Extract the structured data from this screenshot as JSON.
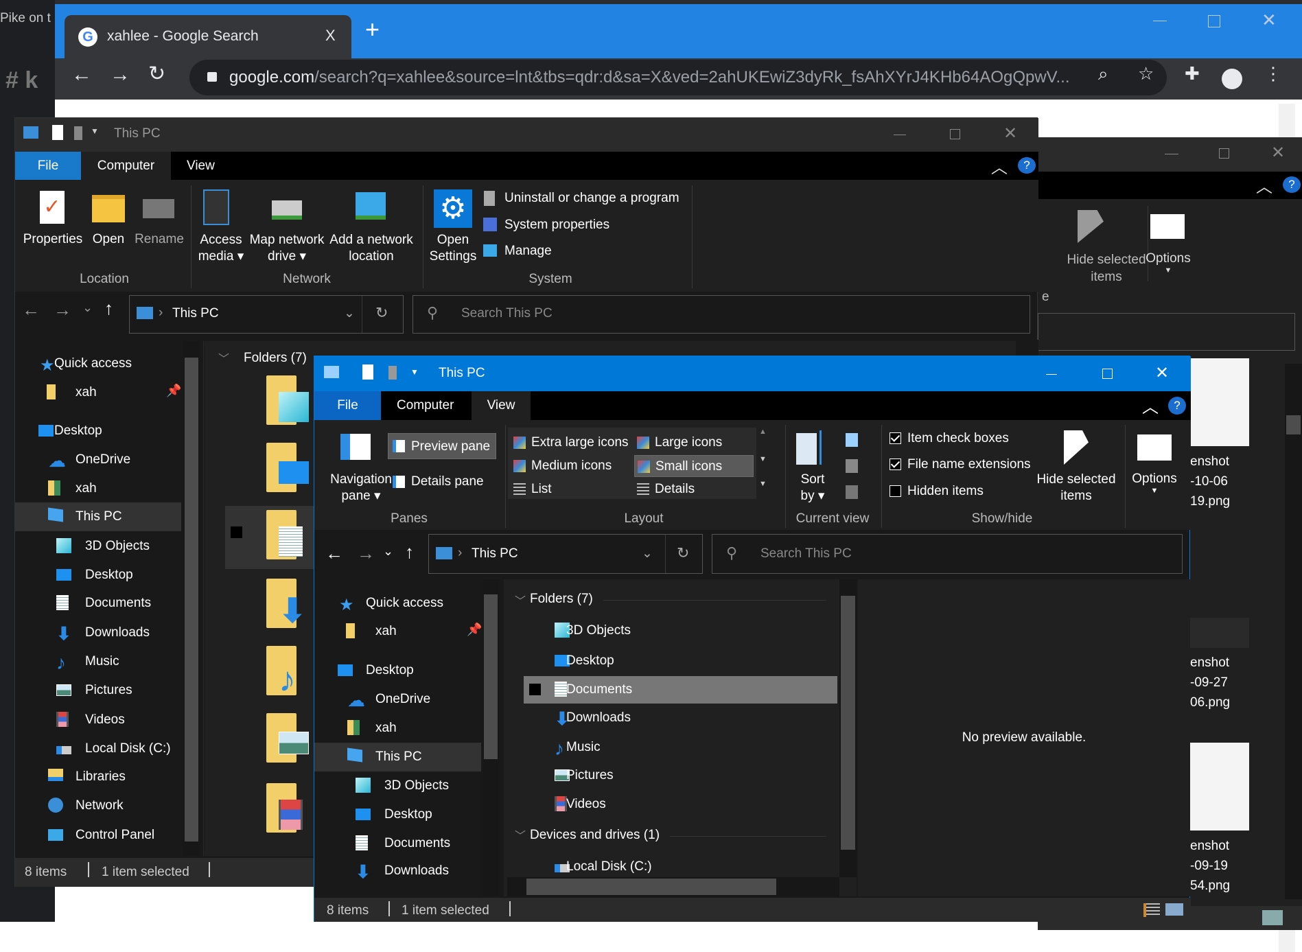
{
  "background": {
    "app_text": "Pike on t",
    "channel_text": "# k"
  },
  "chrome": {
    "tab_title": "xahlee - Google Search",
    "tab_close": "X",
    "new_tab": "+",
    "url_host": "google.com",
    "url_path": "/search?q=xahlee&source=lnt&tbs=qdr:d&sa=X&ved=2ahUKEwiZ3dyRk_fsAhXYrJ4KHb64AOgQpwV...",
    "accent": "#2383e2"
  },
  "right_window": {
    "ribbon": {
      "hide_selected": [
        "Hide selected",
        "items"
      ],
      "options": "Options",
      "partial_label": "e"
    },
    "files": [
      {
        "name": [
          "enshot",
          "-10-06",
          "19.png"
        ]
      },
      {
        "name": [
          "enshot",
          "-09-27",
          "06.png"
        ]
      },
      {
        "name": [
          "enshot",
          "-09-19",
          "54.png"
        ]
      }
    ]
  },
  "back_window": {
    "title": "This PC",
    "tabs": [
      "File",
      "Computer",
      "View"
    ],
    "active_tab": "Computer",
    "ribbon": {
      "location": {
        "label": "Location",
        "buttons": [
          [
            "Properties"
          ],
          [
            "Open"
          ],
          [
            "Rename"
          ]
        ]
      },
      "network": {
        "label": "Network",
        "buttons": [
          [
            "Access",
            "media ▾"
          ],
          [
            "Map network",
            "drive ▾"
          ],
          [
            "Add a network",
            "location"
          ]
        ]
      },
      "system": {
        "label": "System",
        "open_settings": [
          "Open",
          "Settings"
        ],
        "items": [
          "Uninstall or change a program",
          "System properties",
          "Manage"
        ]
      }
    },
    "address": "This PC",
    "search_placeholder": "Search This PC",
    "nav": [
      {
        "label": "Quick access",
        "icon": "star"
      },
      {
        "label": "xah",
        "icon": "folder",
        "pinned": true
      },
      {
        "label": "Desktop",
        "icon": "desktop"
      },
      {
        "label": "OneDrive",
        "icon": "onedrive"
      },
      {
        "label": "xah",
        "icon": "user"
      },
      {
        "label": "This PC",
        "icon": "pc",
        "selected": true
      },
      {
        "label": "3D Objects",
        "icon": "cube"
      },
      {
        "label": "Desktop",
        "icon": "desktop"
      },
      {
        "label": "Documents",
        "icon": "documents"
      },
      {
        "label": "Downloads",
        "icon": "downloads"
      },
      {
        "label": "Music",
        "icon": "music"
      },
      {
        "label": "Pictures",
        "icon": "pictures"
      },
      {
        "label": "Videos",
        "icon": "videos"
      },
      {
        "label": "Local Disk (C:)",
        "icon": "disk"
      },
      {
        "label": "Libraries",
        "icon": "libraries"
      },
      {
        "label": "Network",
        "icon": "network"
      },
      {
        "label": "Control Panel",
        "icon": "control-panel"
      }
    ],
    "folders_header": "Folders (7)",
    "folder_icons": [
      "cube",
      "desktop",
      "documents",
      "downloads",
      "music",
      "pictures",
      "videos"
    ],
    "selected_folder_index": 2,
    "status": {
      "count": "8 items",
      "selected": "1 item selected"
    }
  },
  "front_window": {
    "title": "This PC",
    "tabs": [
      "File",
      "Computer",
      "View"
    ],
    "active_tab": "View",
    "accent": "#0078d7",
    "ribbon": {
      "panes": {
        "label": "Panes",
        "navigation_pane": [
          "Navigation",
          "pane ▾"
        ],
        "preview_pane": "Preview pane",
        "details_pane": "Details pane"
      },
      "layout": {
        "label": "Layout",
        "options": [
          "Extra large icons",
          "Large icons",
          "Medium icons",
          "Small icons",
          "List",
          "Details"
        ],
        "selected": "Small icons"
      },
      "current_view": {
        "label": "Current view",
        "sort_by": [
          "Sort",
          "by ▾"
        ]
      },
      "show_hide": {
        "label": "Show/hide",
        "item_check_boxes": true,
        "file_name_extensions": true,
        "hidden_items": false,
        "labels": [
          "Item check boxes",
          "File name extensions",
          "Hidden items"
        ],
        "hide_selected": [
          "Hide selected",
          "items"
        ]
      },
      "options": "Options"
    },
    "address": "This PC",
    "search_placeholder": "Search This PC",
    "nav": [
      {
        "label": "Quick access",
        "icon": "star"
      },
      {
        "label": "xah",
        "icon": "folder",
        "pinned": true
      },
      {
        "label": "Desktop",
        "icon": "desktop"
      },
      {
        "label": "OneDrive",
        "icon": "onedrive"
      },
      {
        "label": "xah",
        "icon": "user"
      },
      {
        "label": "This PC",
        "icon": "pc",
        "selected": true
      },
      {
        "label": "3D Objects",
        "icon": "cube"
      },
      {
        "label": "Desktop",
        "icon": "desktop"
      },
      {
        "label": "Documents",
        "icon": "documents"
      },
      {
        "label": "Downloads",
        "icon": "downloads"
      }
    ],
    "folders_header": "Folders (7)",
    "folders": [
      {
        "label": "3D Objects",
        "icon": "cube"
      },
      {
        "label": "Desktop",
        "icon": "desktop"
      },
      {
        "label": "Documents",
        "icon": "documents",
        "selected": true
      },
      {
        "label": "Downloads",
        "icon": "downloads"
      },
      {
        "label": "Music",
        "icon": "music"
      },
      {
        "label": "Pictures",
        "icon": "pictures"
      },
      {
        "label": "Videos",
        "icon": "videos"
      }
    ],
    "devices_header": "Devices and drives (1)",
    "devices": [
      {
        "label": "Local Disk (C:)",
        "icon": "disk"
      }
    ],
    "preview_text": "No preview available.",
    "status": {
      "count": "8 items",
      "selected": "1 item selected"
    }
  }
}
